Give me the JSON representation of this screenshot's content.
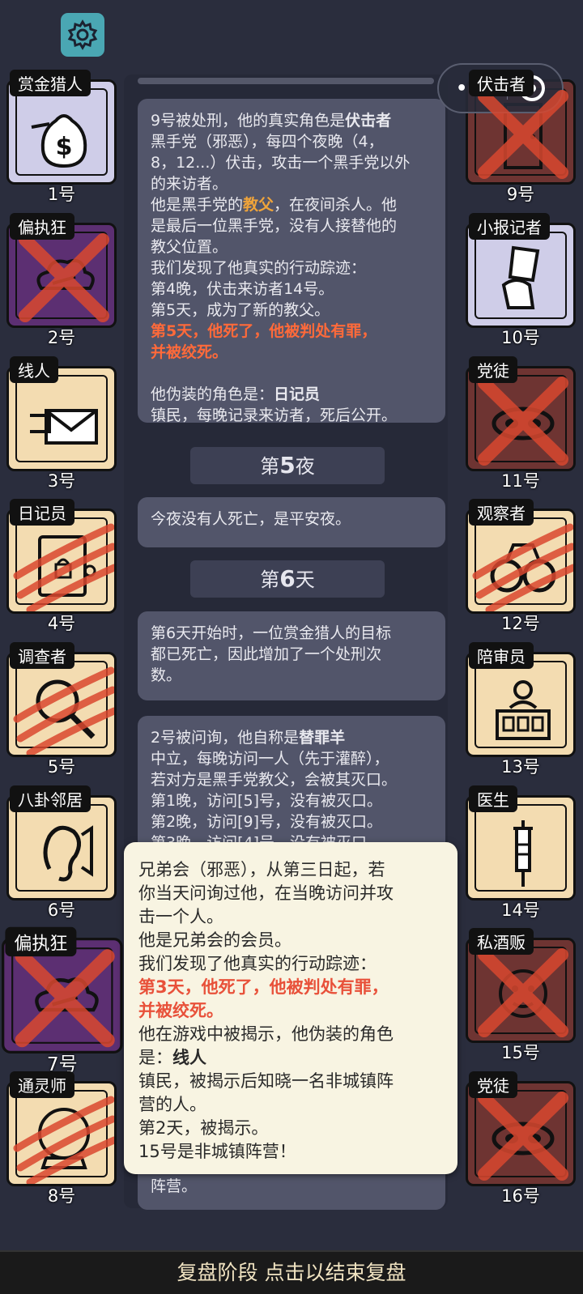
{
  "icons": {
    "settings": "gear-icon",
    "menu": "more-dots-icon",
    "close": "target-icon"
  },
  "colors": {
    "accent": "#4aa7b3",
    "kill_red": "#d9482f",
    "highlight_red": "#ff6a3a",
    "godfather": "#f0a43a"
  },
  "capsule": {
    "dots": "•••"
  },
  "players_left": [
    {
      "tag": "赏金猎人",
      "num": "1号",
      "state": "alive",
      "icon": "money-bag-icon"
    },
    {
      "tag": "偏执狂",
      "num": "2号",
      "state": "executed",
      "icon": "cloud-icon"
    },
    {
      "tag": "线人",
      "num": "3号",
      "state": "alive",
      "icon": "envelope-icon"
    },
    {
      "tag": "日记员",
      "num": "4号",
      "state": "killed",
      "icon": "diary-icon"
    },
    {
      "tag": "调查者",
      "num": "5号",
      "state": "killed",
      "icon": "magnifier-icon"
    },
    {
      "tag": "八卦邻居",
      "num": "6号",
      "state": "alive",
      "icon": "ear-icon"
    },
    {
      "tag": "偏执狂",
      "num": "7号",
      "state": "executed",
      "icon": "cloud-icon"
    },
    {
      "tag": "通灵师",
      "num": "8号",
      "state": "killed",
      "icon": "crystal-ball-icon"
    }
  ],
  "players_right": [
    {
      "tag": "伏击者",
      "num": "9号",
      "state": "executed",
      "icon": "door-icon"
    },
    {
      "tag": "小报记者",
      "num": "10号",
      "state": "alive",
      "icon": "newspaper-icon"
    },
    {
      "tag": "党徒",
      "num": "11号",
      "state": "executed",
      "icon": "mask-icon"
    },
    {
      "tag": "观察者",
      "num": "12号",
      "state": "killed",
      "icon": "binoculars-icon"
    },
    {
      "tag": "陪审员",
      "num": "13号",
      "state": "alive",
      "icon": "jury-icon"
    },
    {
      "tag": "医生",
      "num": "14号",
      "state": "alive",
      "icon": "syringe-icon"
    },
    {
      "tag": "私酒贩",
      "num": "15号",
      "state": "executed",
      "icon": "face-icon"
    },
    {
      "tag": "党徒",
      "num": "16号",
      "state": "executed",
      "icon": "mask-icon"
    }
  ],
  "log": {
    "m1": {
      "l1a": "9号被处刑，他的真实角色是",
      "l1b": "伏击者",
      "l2": "黑手党（邪恶），每四个夜晚（4，",
      "l3": "8，12...）伏击，攻击一个黑手党以外",
      "l4": "的来访者。",
      "l5a": "他是黑手党的",
      "l5b": "教父",
      "l5c": "，在夜间杀人。他",
      "l6": "是最后一位黑手党，没有人接替他的",
      "l7": "教父位置。",
      "l8": "我们发现了他真实的行动踪迹：",
      "l9": "第4晚，伏击来访者14号。",
      "l10": "第5天，成为了新的教父。",
      "l11": "第5天，他死了，他被判处有罪，",
      "l12": "并被绞死。",
      "l13a": "他伪装的角色是：",
      "l13b": "日记员",
      "l14": "镇民，每晚记录来访者，死后公开。"
    },
    "h1": {
      "pre": "第",
      "n": "5",
      "post": "夜"
    },
    "m2": "今夜没有人死亡，是平安夜。",
    "h2": {
      "pre": "第",
      "n": "6",
      "post": "天"
    },
    "m3": {
      "l1": "第6天开始时，一位赏金猎人的目标",
      "l2": "都已死亡，因此增加了一个处刑次",
      "l3": "数。"
    },
    "m4": {
      "l1a": "2号被问询，他自称是",
      "l1b": "替罪羊",
      "l2": "中立，每晚访问一人（先于灌醉），",
      "l3": "若对方是黑手党教父，会被其灭口。",
      "l4": "第1晚，访问[5]号，没有被灭口。",
      "l5": "第2晚，访问[9]号，没有被灭口。",
      "l6": "第3晚，访问[4]号，没有被灭口",
      "tail": "阵营。"
    }
  },
  "popup": {
    "l1": "兄弟会（邪恶），从第三日起，若",
    "l2": "你当天问询过他，在当晚访问并攻",
    "l3": "击一个人。",
    "l4": "他是兄弟会的会员。",
    "l5": "我们发现了他真实的行动踪迹：",
    "l6": "第3天，他死了，他被判处有罪，",
    "l7": "并被绞死。",
    "l8": "他在游戏中被揭示，他伪装的角色",
    "l9a": "是：",
    "l9b": "线人",
    "l10": "镇民，被揭示后知晓一名非城镇阵",
    "l11": "营的人。",
    "l12": "第2天，被揭示。",
    "l13": "15号是非城镇阵营！"
  },
  "bottom": {
    "label": "复盘阶段 点击以结束复盘"
  }
}
